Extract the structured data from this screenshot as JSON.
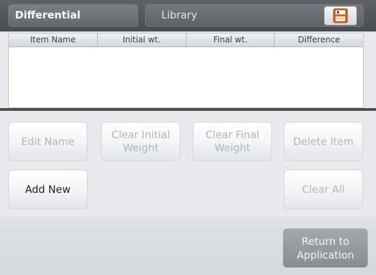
{
  "header": {
    "active_tab": "Differential",
    "library_tab": "Library",
    "save_icon": "floppy-disk-icon"
  },
  "table": {
    "columns": [
      "Item Name",
      "Initial wt.",
      "Final wt.",
      "Difference"
    ],
    "rows": []
  },
  "buttons": {
    "edit_name": "Edit Name",
    "clear_initial_line1": "Clear Initial",
    "clear_initial_line2": "Weight",
    "clear_final_line1": "Clear Final",
    "clear_final_line2": "Weight",
    "delete_item": "Delete Item",
    "add_new": "Add New",
    "clear_all": "Clear All",
    "return_line1": "Return to",
    "return_line2": "Application"
  },
  "colors": {
    "header_bg": "#54565a",
    "disabled_text": "#b3b4b8",
    "active_text": "#222222",
    "return_button": "#9a9ca1"
  }
}
